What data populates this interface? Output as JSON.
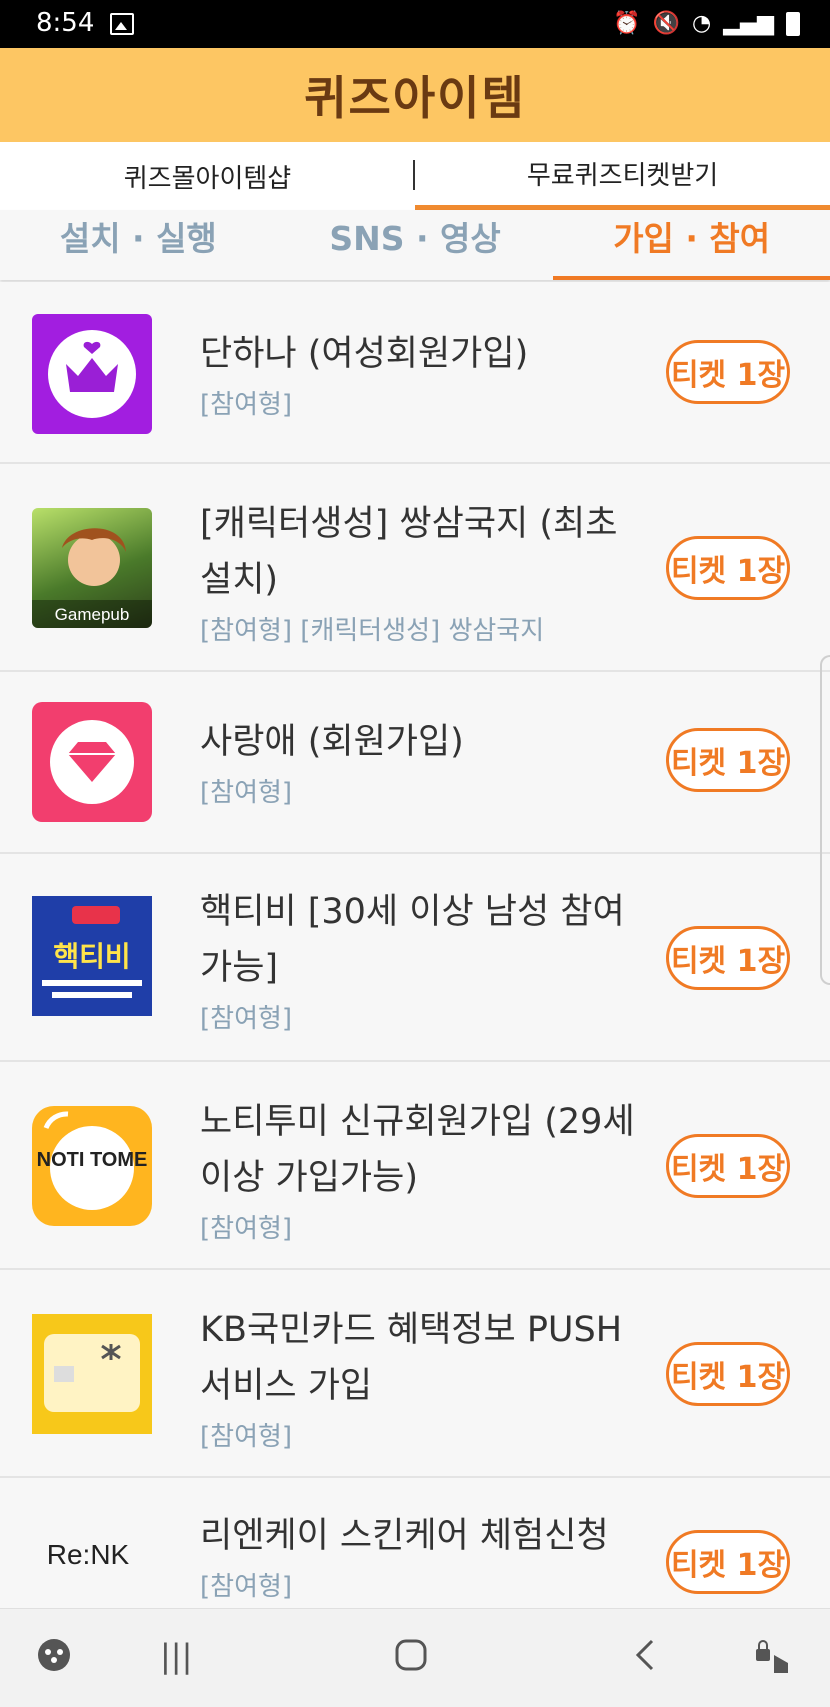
{
  "status": {
    "time": "8:54"
  },
  "header": {
    "title": "퀴즈아이템"
  },
  "top_tabs": [
    {
      "label": "퀴즈몰아이템샵"
    },
    {
      "label": "무료퀴즈티켓받기"
    }
  ],
  "sub_tabs": [
    {
      "label": "설치 · 실행"
    },
    {
      "label": "SNS · 영상"
    },
    {
      "label": "가입 · 참여"
    }
  ],
  "items": [
    {
      "name": "단하나 (여성회원가입)",
      "tag": "[참여형]",
      "button": "티켓 1장"
    },
    {
      "name": "[캐릭터생성] 쌍삼국지 (최초 설치)",
      "tag": "[참여형] [캐릭터생성] 쌍삼국지",
      "button": "티켓 1장",
      "thumb_label": "Gamepub"
    },
    {
      "name": "사랑애 (회원가입)",
      "tag": "[참여형]",
      "button": "티켓 1장"
    },
    {
      "name": "핵티비 [30세 이상 남성 참여 가능]",
      "tag": "[참여형]",
      "button": "티켓 1장",
      "thumb_label": "핵티비"
    },
    {
      "name": "노티투미 신규회원가입 (29세 이상 가입가능)",
      "tag": "[참여형]",
      "button": "티켓 1장",
      "thumb_label": "NOTI TOME"
    },
    {
      "name": "KB국민카드 혜택정보 PUSH 서비스 가입",
      "tag": "[참여형]",
      "button": "티켓 1장"
    },
    {
      "name": "리엔케이 스킨케어 체험신청",
      "tag": "[참여형]",
      "button": "티켓 1장",
      "thumb_label": "Re:NK"
    }
  ],
  "colors": {
    "accent": "#f07a24",
    "header_bg": "#fdc663",
    "title": "#6a3a12"
  }
}
